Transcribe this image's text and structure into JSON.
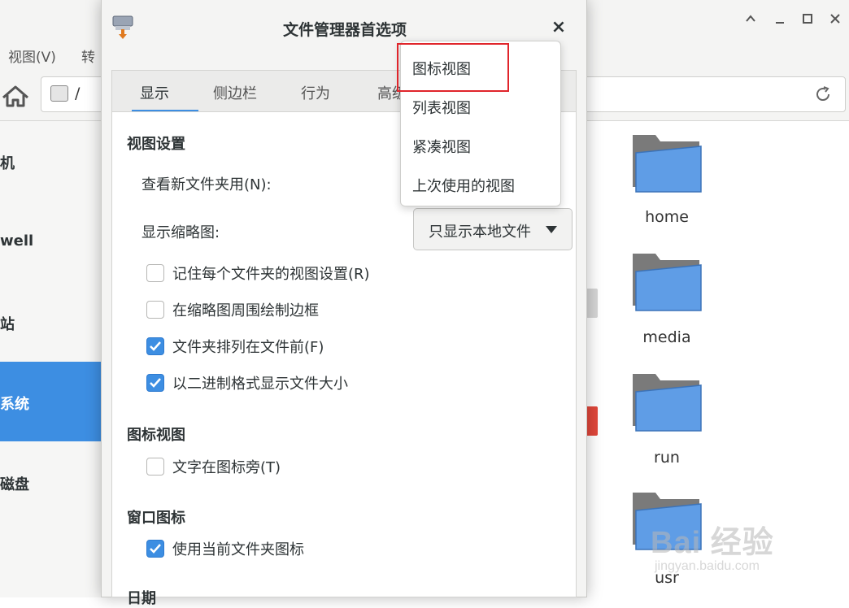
{
  "background_window": {
    "menu": [
      "视图(V)",
      "转"
    ],
    "path": "/",
    "sidebar": [
      {
        "label": "机",
        "active": false
      },
      {
        "label": "well",
        "active": false
      },
      {
        "label": "站",
        "active": false
      },
      {
        "label": "系统",
        "active": true
      },
      {
        "label": "磁盘",
        "active": false
      }
    ],
    "folders": [
      "home",
      "media",
      "run",
      "usr"
    ],
    "window_controls": {
      "up": "^",
      "minimize": "_",
      "maximize": "□",
      "close": "✕"
    }
  },
  "dialog": {
    "title": "文件管理器首选项",
    "close_icon": "×",
    "tabs": [
      {
        "label": "显示",
        "active": true
      },
      {
        "label": "侧边栏",
        "active": false
      },
      {
        "label": "行为",
        "active": false
      },
      {
        "label": "高级",
        "active": false
      }
    ],
    "view_settings": {
      "heading": "视图设置",
      "new_folder_label": "查看新文件夹用(N):",
      "thumbnail_label": "显示缩略图:",
      "thumbnail_value": "只显示本地文件",
      "checkboxes": [
        {
          "label": "记住每个文件夹的视图设置(R)",
          "checked": false
        },
        {
          "label": "在缩略图周围绘制边框",
          "checked": false
        },
        {
          "label": "文件夹排列在文件前(F)",
          "checked": true
        },
        {
          "label": "以二进制格式显示文件大小",
          "checked": true
        }
      ]
    },
    "icon_view": {
      "heading": "图标视图",
      "checkboxes": [
        {
          "label": "文字在图标旁(T)",
          "checked": false
        }
      ]
    },
    "window_icon": {
      "heading": "窗口图标",
      "checkboxes": [
        {
          "label": "使用当前文件夹图标",
          "checked": true
        }
      ]
    },
    "date": {
      "heading": "日期"
    }
  },
  "popup": {
    "options": [
      "图标视图",
      "列表视图",
      "紧凑视图",
      "上次使用的视图"
    ],
    "highlighted": "图标视图"
  },
  "watermark": {
    "text": "Bai  经验",
    "url": "jingyan.baidu.com"
  },
  "colors": {
    "accent": "#3d8ee2",
    "highlight_box": "#e0252b",
    "folder_blue": "#5f9de6"
  }
}
